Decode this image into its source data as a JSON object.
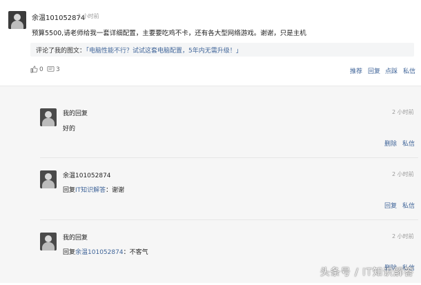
{
  "comment": {
    "username": "余温101052874",
    "time": "3 小时前",
    "content": "预算5500,请老师给我一套详细配置，主要要吃鸡不卡，还有各大型网络游戏。谢谢，只是主机",
    "quote_prefix": "评论了我的图文：",
    "quote_text": "「电脑性能不行？试试这套电脑配置，5年内无需升级！」",
    "like_count": "0",
    "comment_count": "3",
    "actions": {
      "recommend": "推荐",
      "reply": "回复",
      "dislike": "点踩",
      "message": "私信"
    }
  },
  "replies": [
    {
      "author": "我的回复",
      "time": "2 小时前",
      "text": "好的",
      "actions": [
        "删除",
        "私信"
      ]
    },
    {
      "author": "余温101052874",
      "time": "2 小时前",
      "reply_prefix": "回复",
      "reply_to": "IT知识解答",
      "reply_suffix": "：谢谢",
      "actions": [
        "回复",
        "私信"
      ]
    },
    {
      "author": "我的回复",
      "time": "2 小时前",
      "reply_prefix": "回复",
      "reply_to": "余温101052874",
      "reply_suffix": "：不客气",
      "actions": [
        "删除",
        "私信"
      ]
    }
  ],
  "watermark": "头条号 / IT知识解答"
}
